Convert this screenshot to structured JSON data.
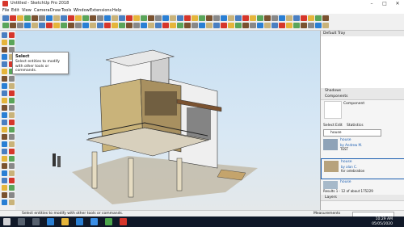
{
  "window": {
    "title": "Untitled - SketchUp Pro 2018"
  },
  "menu": [
    "File",
    "Edit",
    "View",
    "Camera",
    "Draw",
    "Tools",
    "Window",
    "Extensions",
    "Help"
  ],
  "tooltip": {
    "title": "Select",
    "body": "Select entities to modify with other tools or commands."
  },
  "tray": {
    "header": "Default Tray",
    "shadows": "Shadows",
    "components": "Components",
    "component_label": "Component",
    "tabs": [
      "Select",
      "Edit",
      "Statistics"
    ],
    "search_value": "house",
    "items": [
      {
        "name": "house",
        "by": "by Andrew M.",
        "extra": "TEST"
      },
      {
        "name": "house",
        "by": "by alan C.",
        "extra": "for celebration"
      },
      {
        "name": "house",
        "by": "",
        "extra": ""
      }
    ],
    "results": "Results 1 - 12 of about 175229",
    "layers": "Layers"
  },
  "status": {
    "message": "Select entities to modify with other tools or commands.",
    "measurements": "Measurements"
  },
  "taskbar": {
    "time": "10:29 AM",
    "date": "05/05/2020"
  },
  "colors": {
    "accent": "#d6362b",
    "taskbar": "#101828",
    "sky": "#c7dff2"
  }
}
